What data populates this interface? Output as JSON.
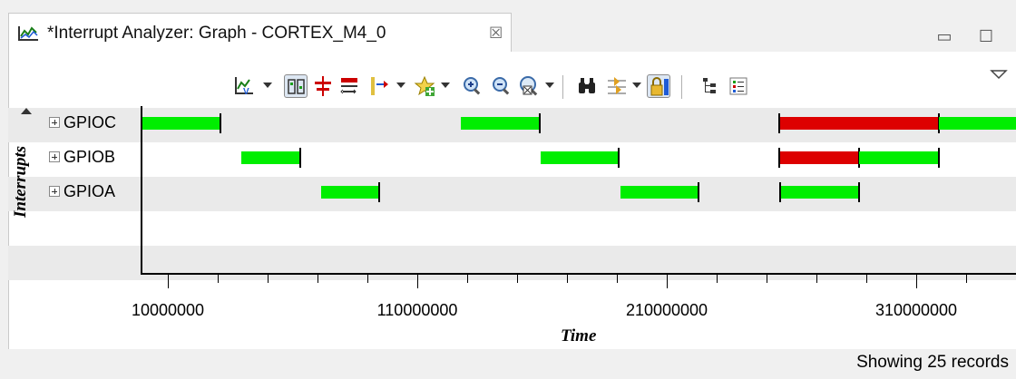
{
  "tab": {
    "title": "*Interrupt Analyzer: Graph - CORTEX_M4_0",
    "close_glyph": "☒",
    "icon": "graph-chart-icon"
  },
  "window_controls": {
    "minimize_glyph": "▭",
    "maximize_glyph": "☐"
  },
  "toolbar": {
    "buttons": [
      "chart-type-icon",
      "align-icon",
      "measure-icon",
      "zoom-range-icon",
      "markers-icon",
      "bookmark-icon",
      "zoom-in-icon",
      "zoom-out-icon",
      "zoom-fit-icon",
      "find-icon",
      "sync-icon",
      "lock-icon",
      "tree-icon",
      "legend-icon"
    ]
  },
  "chart_data": {
    "type": "gantt",
    "xlabel": "Time",
    "ylabel": "Interrupts",
    "x_ticks": [
      "10000000",
      "110000000",
      "210000000",
      "310000000"
    ],
    "rows": [
      {
        "label": "GPIOC"
      },
      {
        "label": "GPIOB"
      },
      {
        "label": "GPIOA"
      }
    ],
    "colors": {
      "active": "#00ee00",
      "preempted": "#dd0000"
    }
  },
  "status": {
    "text": "Showing 25 records"
  }
}
